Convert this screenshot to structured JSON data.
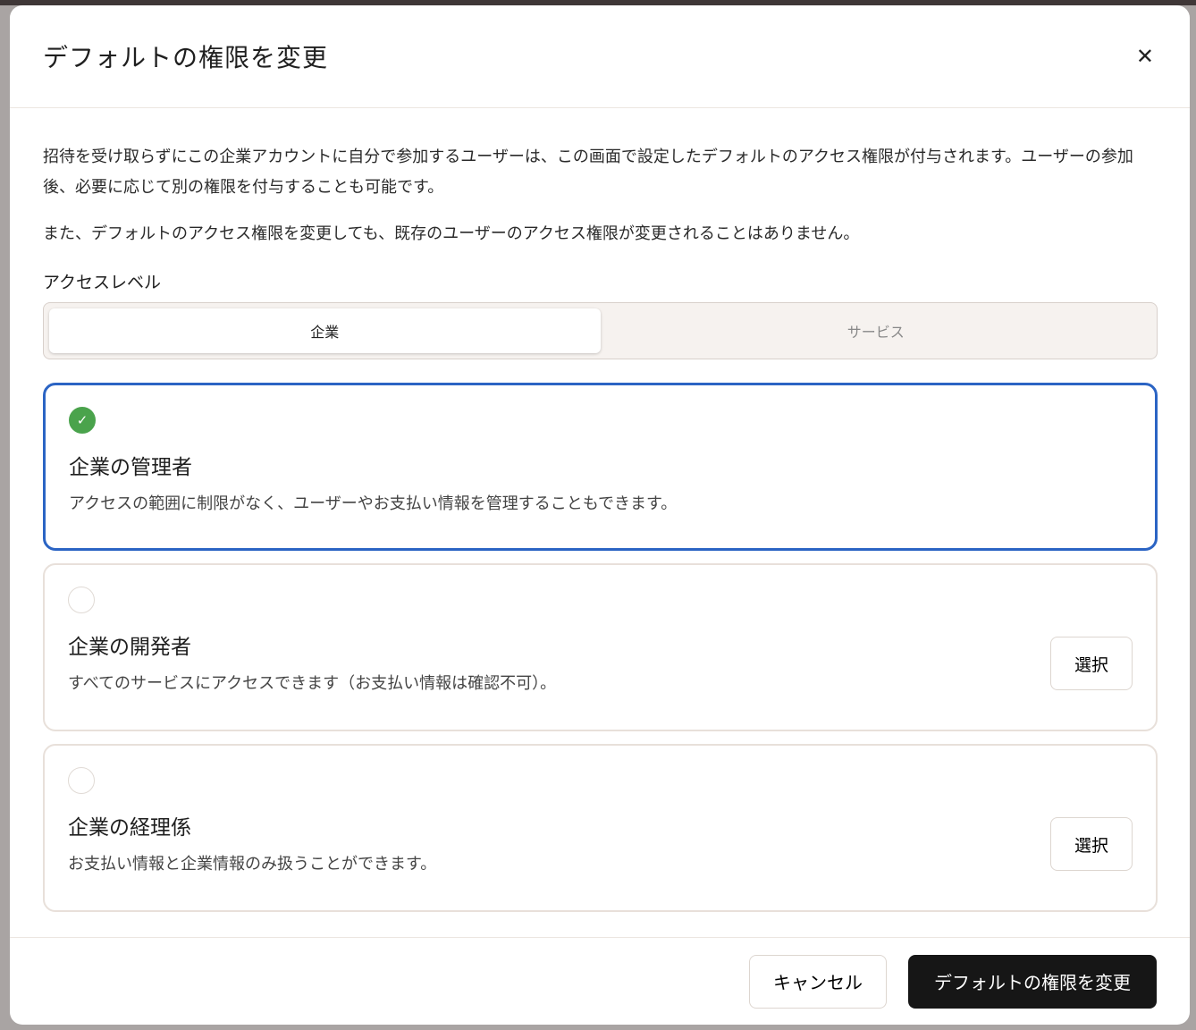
{
  "dialog": {
    "title": "デフォルトの権限を変更",
    "close_icon": "close-icon",
    "description": "招待を受け取らずにこの企業アカウントに自分で参加するユーザーは、この画面で設定したデフォルトのアクセス権限が付与されます。ユーザーの参加後、必要に応じて別の権限を付与することも可能です。",
    "note": "また、デフォルトのアクセス権限を変更しても、既存のユーザーのアクセス権限が変更されることはありません。",
    "access_level_label": "アクセスレベル",
    "tabs": [
      {
        "label": "企業",
        "active": true
      },
      {
        "label": "サービス",
        "active": false
      }
    ],
    "roles": [
      {
        "title": "企業の管理者",
        "description": "アクセスの範囲に制限がなく、ユーザーやお支払い情報を管理することもできます。",
        "selected": true
      },
      {
        "title": "企業の開発者",
        "description": "すべてのサービスにアクセスできます（お支払い情報は確認不可）。",
        "selected": false,
        "button": "選択"
      },
      {
        "title": "企業の経理係",
        "description": "お支払い情報と企業情報のみ扱うことができます。",
        "selected": false,
        "button": "選択"
      }
    ],
    "cancel_label": "キャンセル",
    "submit_label": "デフォルトの権限を変更"
  },
  "colors": {
    "selected_border": "#2b64c4",
    "check": "#4aa34c",
    "primary": "#161616"
  }
}
